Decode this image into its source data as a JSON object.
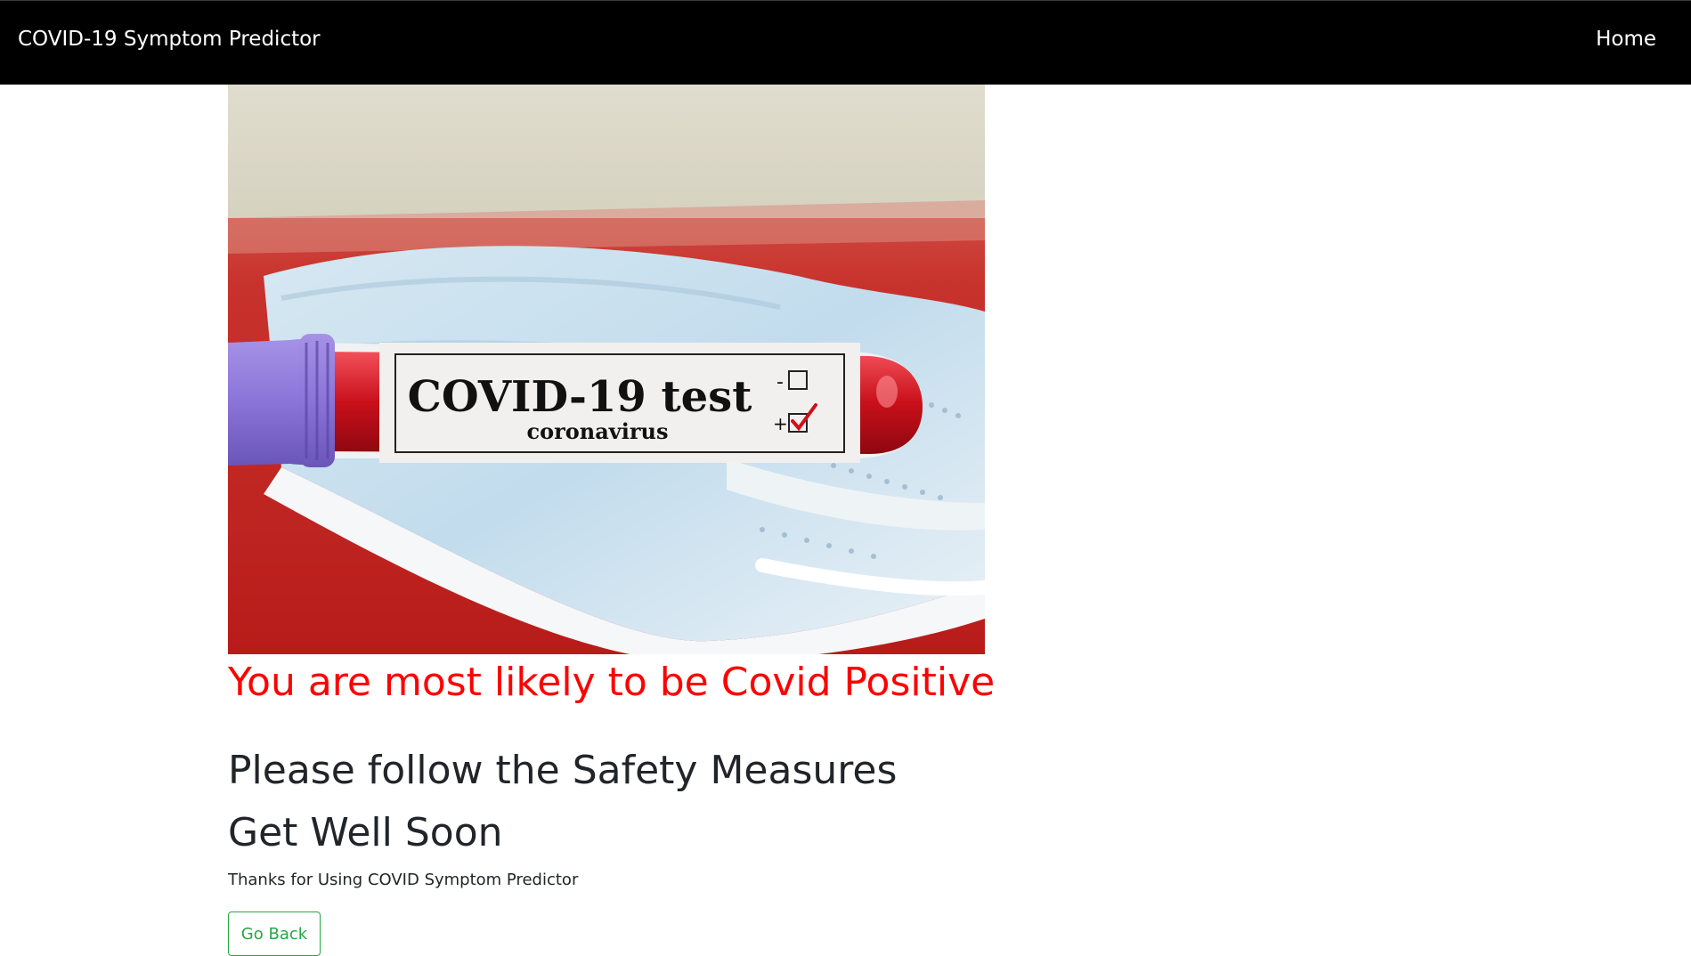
{
  "navbar": {
    "brand": "COVID-19 Symptom Predictor",
    "home_link": "Home"
  },
  "hero_image": {
    "tube_label_title": "COVID-19 test",
    "tube_label_subtitle": "coronavirus",
    "negative_mark": "-",
    "positive_mark": "+"
  },
  "result": {
    "prediction": "You are most likely to be Covid Positive",
    "advice_line1": "Please follow the Safety Measures",
    "advice_line2": "Get Well Soon",
    "thanks": "Thanks for Using COVID Symptom Predictor",
    "go_back_label": "Go Back"
  },
  "colors": {
    "navbar_bg": "#000000",
    "result_text": "#ff0000",
    "button_outline": "#28a745"
  }
}
